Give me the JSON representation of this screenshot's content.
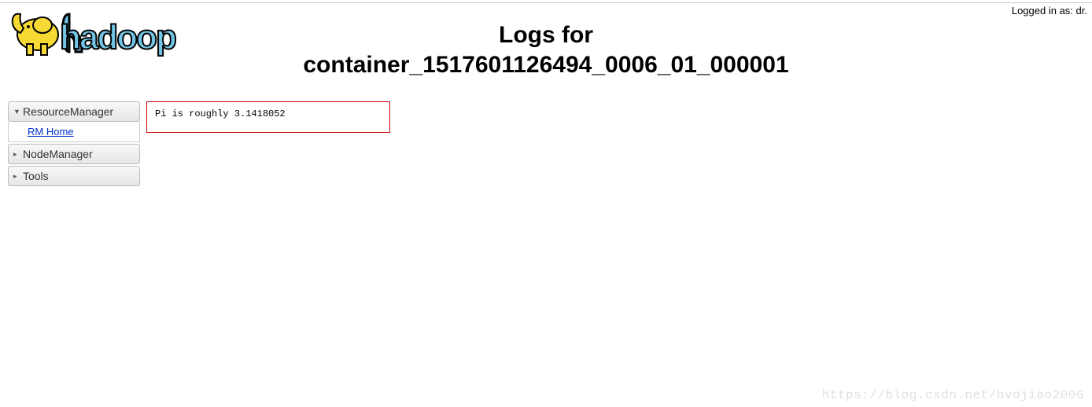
{
  "login": {
    "prefix": "Logged in as: ",
    "user": "dr."
  },
  "header": {
    "title_line1": "Logs for",
    "title_line2": "container_1517601126494_0006_01_000001"
  },
  "sidebar": {
    "sections": [
      {
        "label": "ResourceManager",
        "expanded": true,
        "items": [
          {
            "label": "RM Home"
          }
        ]
      },
      {
        "label": "NodeManager",
        "expanded": false,
        "items": []
      },
      {
        "label": "Tools",
        "expanded": false,
        "items": []
      }
    ]
  },
  "log": {
    "content": "Pi is roughly 3.1418052"
  },
  "watermark": "https://blog.csdn.net/hvojiao2006"
}
